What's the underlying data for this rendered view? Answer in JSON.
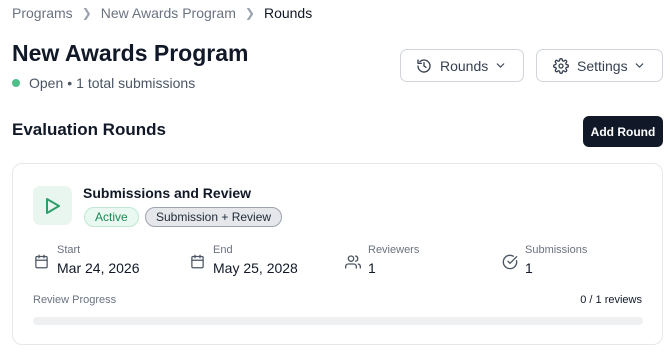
{
  "breadcrumb": {
    "items": [
      "Programs",
      "New Awards Program",
      "Rounds"
    ]
  },
  "header": {
    "title": "New Awards Program",
    "status": "Open",
    "submissions_summary": "1 total submissions",
    "status_separator": "•",
    "rounds_button": "Rounds",
    "settings_button": "Settings"
  },
  "section": {
    "title": "Evaluation Rounds",
    "add_button": "Add Round"
  },
  "round": {
    "name": "Submissions and Review",
    "status_badge": "Active",
    "type_badge": "Submission + Review",
    "start_label": "Start",
    "start_value": "Mar 24, 2026",
    "end_label": "End",
    "end_value": "May 25, 2028",
    "reviewers_label": "Reviewers",
    "reviewers_value": "1",
    "submissions_label": "Submissions",
    "submissions_value": "1",
    "progress_label": "Review Progress",
    "progress_text": "0 / 1 reviews",
    "progress_fraction": 0
  },
  "colors": {
    "status_open": "#4fbf8b",
    "primary_button": "#111827",
    "active_badge_text": "#1e8a55",
    "play_icon": "#2f9e6a"
  },
  "icons": {
    "rounds": "history-icon",
    "settings": "gear-icon",
    "round": "play-icon",
    "start": "calendar-icon",
    "end": "calendar-icon",
    "reviewers": "users-icon",
    "submissions": "check-circle-icon"
  }
}
